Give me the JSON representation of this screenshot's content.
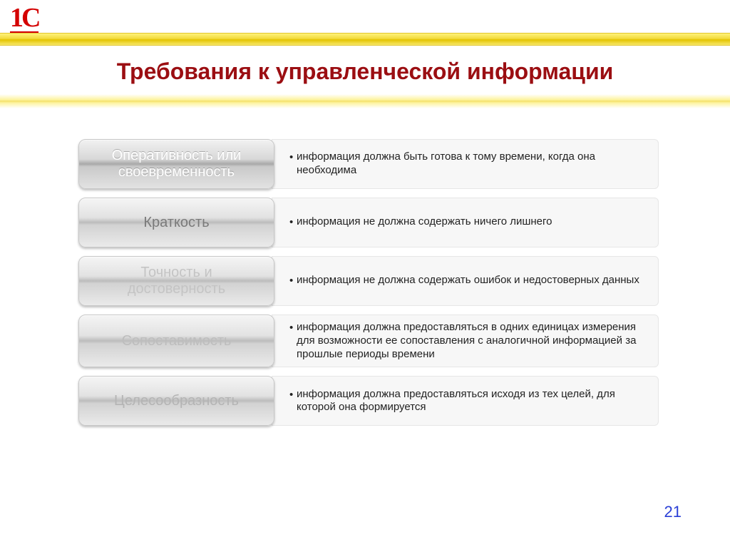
{
  "logo": "1С",
  "title": "Требования к управленческой информации",
  "rows": [
    {
      "label": "Оперативность или своевременность",
      "desc": "информация должна быть готова к тому времени, когда она необходима"
    },
    {
      "label": "Краткость",
      "desc": "информация не должна содержать ничего лишнего"
    },
    {
      "label": "Точность и достоверность",
      "desc": "информация не должна содержать ошибок и недостоверных данных"
    },
    {
      "label": "Сопоставимость",
      "desc": "информация должна предоставляться в одних единицах измерения для возможности ее сопоставления с аналогичной информацией за прошлые периоды времени"
    },
    {
      "label": "Целесообразность",
      "desc": "информация должна предоставляться исходя из тех целей, для которой она формируется"
    }
  ],
  "page_number": "21"
}
